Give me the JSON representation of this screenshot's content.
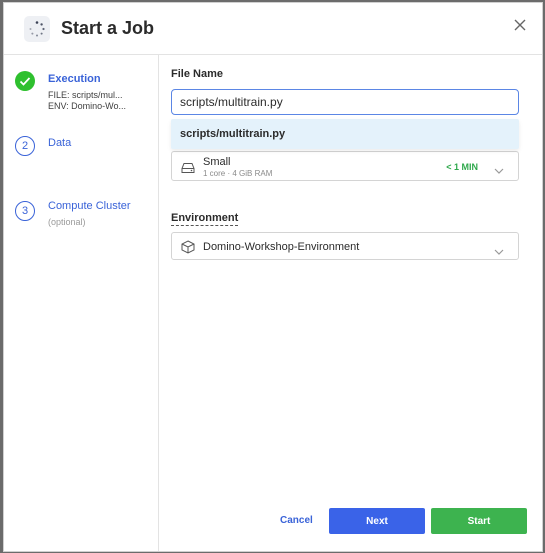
{
  "header": {
    "title": "Start a Job",
    "icon": "spinner-icon"
  },
  "steps": [
    {
      "title": "Execution",
      "status": "done",
      "lines": [
        "FILE: scripts/mul...",
        "ENV: Domino-Wo..."
      ]
    },
    {
      "number": "2",
      "title": "Data"
    },
    {
      "number": "3",
      "title": "Compute Cluster",
      "sub": "(optional)"
    }
  ],
  "form": {
    "file_name_label": "File Name",
    "file_input_value": "scripts/multitrain.py",
    "suggestion": "scripts/multitrain.py",
    "hardware": {
      "name": "Small",
      "spec": "1 core · 4 GiB RAM",
      "time": "< 1 MIN"
    },
    "environment_label": "Environment",
    "environment_value": "Domino-Workshop-Environment"
  },
  "footer": {
    "cancel": "Cancel",
    "next": "Next",
    "start": "Start"
  },
  "colors": {
    "accent": "#3a63e8",
    "success": "#3db34f",
    "suggestion_bg": "#e4f2fb"
  }
}
